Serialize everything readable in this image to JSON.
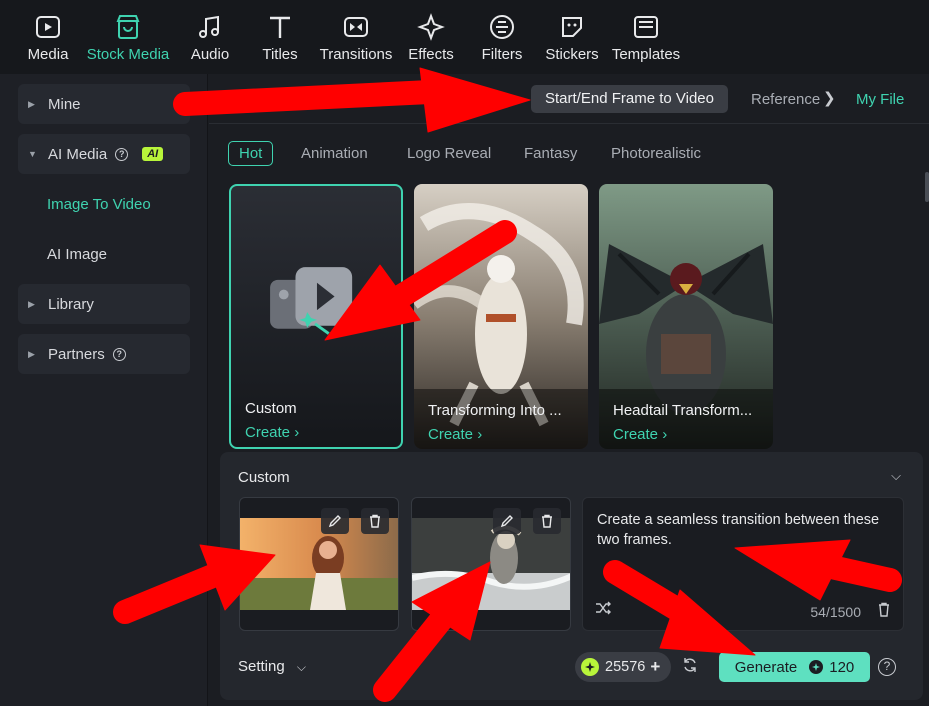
{
  "toolbar": {
    "items": [
      {
        "label": "Media",
        "icon": "media-icon"
      },
      {
        "label": "Stock Media",
        "icon": "stock-media-icon",
        "active": true
      },
      {
        "label": "Audio",
        "icon": "music-note-icon"
      },
      {
        "label": "Titles",
        "icon": "text-t-icon"
      },
      {
        "label": "Transitions",
        "icon": "transitions-icon"
      },
      {
        "label": "Effects",
        "icon": "effects-sparkle-icon"
      },
      {
        "label": "Filters",
        "icon": "filters-icon"
      },
      {
        "label": "Stickers",
        "icon": "sticker-icon"
      },
      {
        "label": "Templates",
        "icon": "templates-icon"
      }
    ]
  },
  "sidebar": {
    "mine": "Mine",
    "ai_media": "AI Media",
    "ai_badge": "AI",
    "image_to_video": "Image To Video",
    "ai_image": "AI Image",
    "library": "Library",
    "partners": "Partners"
  },
  "tabs": {
    "start_end": "Start/End Frame to Video",
    "reference": "Reference",
    "my_file": "My File"
  },
  "categories": [
    "Hot",
    "Animation",
    "Logo Reveal",
    "Fantasy",
    "Photorealistic"
  ],
  "cards": [
    {
      "title": "Custom",
      "action": "Create ›"
    },
    {
      "title": "Transforming Into ...",
      "action": "Create ›"
    },
    {
      "title": "Headtail Transform...",
      "action": "Create ›"
    }
  ],
  "panel": {
    "title": "Custom",
    "prompt": "Create a seamless transition between these two frames.",
    "count": "54/1500",
    "setting": "Setting",
    "credits": "25576",
    "generate_label": "Generate",
    "generate_cost": "120"
  },
  "colors": {
    "accent": "#3fd3b0",
    "generate_bg": "#5ee0c0",
    "ai_badge": "#b8f53a",
    "annotation_arrow": "#ff0000"
  }
}
